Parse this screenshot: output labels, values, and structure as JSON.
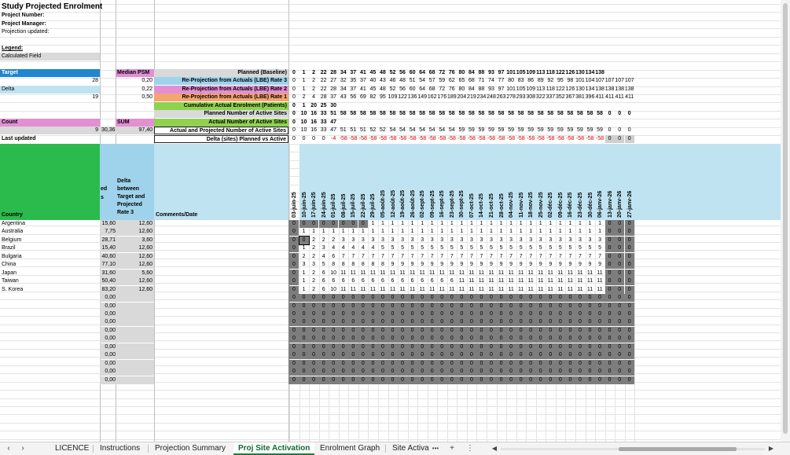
{
  "header": {
    "title": "Study Projected Enrolment",
    "project_number_label": "Project Number:",
    "project_manager_label": "Project Manager:",
    "projection_updated_label": "Projection updated:",
    "legend_label": "Legend:",
    "calculated_field_label": "Calculated Field"
  },
  "stats": {
    "target_label": "Target",
    "target_value": "28",
    "delta_label": "Delta",
    "delta_value": "19",
    "median_psm_label": "Median PSM",
    "median_values": [
      "0,20",
      "0,22",
      "0,50"
    ],
    "count_label": "Count",
    "count_value": "9",
    "count_mid": "30,36",
    "sum_label": "SUM",
    "sum_value": "97,40",
    "last_updated_label": "Last updated"
  },
  "row_labels": [
    "Planned (Baseline)",
    "Re-Projection  from Actuals (LBE) Rate 3",
    "Re-Projection  from Actuals (LBE) Rate 2",
    "Re-Projection  from Actuals (LBE) Rate 1",
    "Cumulative Actual Enrolment (Patients)",
    "Planned Number of Active Sites",
    "Actual Number of Active Sites",
    "Actual and Projected Number of Active Sites",
    "Delta (sites) Planned vs Active"
  ],
  "summary_rows": [
    [
      "0",
      "1",
      "2",
      "22",
      "28",
      "34",
      "37",
      "41",
      "45",
      "48",
      "52",
      "56",
      "60",
      "64",
      "68",
      "72",
      "76",
      "80",
      "84",
      "88",
      "93",
      "97",
      "101",
      "105",
      "109",
      "113",
      "118",
      "122",
      "126",
      "130",
      "134",
      "138"
    ],
    [
      "0",
      "1",
      "2",
      "22",
      "27",
      "32",
      "35",
      "37",
      "40",
      "43",
      "46",
      "48",
      "51",
      "54",
      "57",
      "59",
      "62",
      "65",
      "68",
      "71",
      "74",
      "77",
      "80",
      "83",
      "86",
      "89",
      "92",
      "95",
      "98",
      "101",
      "104",
      "107",
      "107",
      "107",
      "107"
    ],
    [
      "0",
      "1",
      "2",
      "22",
      "28",
      "34",
      "37",
      "41",
      "45",
      "48",
      "52",
      "56",
      "60",
      "64",
      "68",
      "72",
      "76",
      "80",
      "84",
      "88",
      "93",
      "97",
      "101",
      "105",
      "109",
      "113",
      "118",
      "122",
      "126",
      "130",
      "134",
      "138",
      "138",
      "138",
      "138"
    ],
    [
      "0",
      "2",
      "4",
      "28",
      "37",
      "43",
      "56",
      "69",
      "82",
      "95",
      "109",
      "122",
      "136",
      "149",
      "162",
      "176",
      "189",
      "204",
      "219",
      "234",
      "248",
      "263",
      "278",
      "293",
      "308",
      "322",
      "337",
      "352",
      "367",
      "381",
      "396",
      "411",
      "411",
      "411",
      "411"
    ],
    [
      "0",
      "1",
      "20",
      "25",
      "30"
    ],
    [
      "0",
      "10",
      "16",
      "33",
      "51",
      "58",
      "58",
      "58",
      "58",
      "58",
      "58",
      "58",
      "58",
      "58",
      "58",
      "58",
      "58",
      "58",
      "58",
      "58",
      "58",
      "58",
      "58",
      "58",
      "58",
      "58",
      "58",
      "58",
      "58",
      "58",
      "58",
      "58",
      "0",
      "0",
      "0"
    ],
    [
      "0",
      "10",
      "16",
      "33",
      "47"
    ],
    [
      "0",
      "10",
      "16",
      "33",
      "47",
      "51",
      "51",
      "51",
      "52",
      "52",
      "54",
      "54",
      "54",
      "54",
      "54",
      "54",
      "54",
      "59",
      "59",
      "59",
      "59",
      "59",
      "59",
      "59",
      "59",
      "59",
      "59",
      "59",
      "59",
      "59",
      "59",
      "59",
      "0",
      "0",
      "0"
    ],
    [
      "0",
      "0",
      "0",
      "0",
      "-4",
      "-58",
      "-58",
      "-58",
      "-58",
      "-58",
      "-58",
      "-58",
      "-58",
      "-58",
      "-58",
      "-58",
      "-58",
      "-58",
      "-58",
      "-58",
      "-58",
      "-58",
      "-58",
      "-58",
      "-58",
      "-58",
      "-58",
      "-58",
      "-58",
      "-58",
      "-58",
      "-58",
      "0",
      "0",
      "0"
    ]
  ],
  "table_headers": {
    "country": "Country",
    "col_b_fragment_1": "ed",
    "col_b_fragment_2": "s",
    "delta_header": "Delta between Target and Projected Rate 3",
    "comments_header": "Comments/Date"
  },
  "dates": [
    "03-juin-25",
    "10-juin-25",
    "17-juin-25",
    "24-juin-25",
    "01-juil-25",
    "08-juil-25",
    "15-juil-25",
    "22-juil-25",
    "29-juil-25",
    "05-août-25",
    "12-août-25",
    "19-août-25",
    "26-août-25",
    "02-sept-25",
    "09-sept-25",
    "16-sept-25",
    "23-sept-25",
    "30-sept-25",
    "07-oct-25",
    "14-oct-25",
    "21-oct-25",
    "28-oct-25",
    "04-nov-25",
    "11-nov-25",
    "18-nov-25",
    "25-nov-25",
    "02-déc-25",
    "09-déc-25",
    "16-déc-25",
    "23-déc-25",
    "30-déc-25",
    "06-janv-26",
    "13-janv-26",
    "20-janv-26",
    "27-janv-26"
  ],
  "countries": [
    {
      "name": "Argentina",
      "b": "15,60",
      "delta": "12,60",
      "cells": [
        "0",
        "0",
        "0",
        "0",
        "0",
        "0",
        "0",
        "0",
        "1",
        "1",
        "1",
        "1",
        "1",
        "1",
        "1",
        "1",
        "1",
        "1",
        "1",
        "1",
        "1",
        "1",
        "1",
        "1",
        "1",
        "1",
        "1",
        "1",
        "1",
        "1",
        "1",
        "1",
        "0",
        "0",
        "0"
      ]
    },
    {
      "name": "Australia",
      "b": "7,75",
      "delta": "12,60",
      "cells": [
        "0",
        "1",
        "1",
        "1",
        "1",
        "1",
        "1",
        "1",
        "1",
        "1",
        "1",
        "1",
        "1",
        "1",
        "1",
        "1",
        "1",
        "1",
        "1",
        "1",
        "1",
        "1",
        "1",
        "1",
        "1",
        "1",
        "1",
        "1",
        "1",
        "1",
        "1",
        "1",
        "0",
        "0",
        "0"
      ]
    },
    {
      "name": "Belgium",
      "b": "28,71",
      "delta": "3,60",
      "cells": [
        "0",
        "0",
        "2",
        "2",
        "2",
        "3",
        "3",
        "3",
        "3",
        "3",
        "3",
        "3",
        "3",
        "3",
        "3",
        "3",
        "3",
        "3",
        "3",
        "3",
        "3",
        "3",
        "3",
        "3",
        "3",
        "3",
        "3",
        "3",
        "3",
        "3",
        "3",
        "3",
        "0",
        "0",
        "0"
      ]
    },
    {
      "name": "Brazil",
      "b": "15,40",
      "delta": "12,60",
      "cells": [
        "0",
        "1",
        "2",
        "3",
        "4",
        "4",
        "4",
        "4",
        "4",
        "5",
        "5",
        "5",
        "5",
        "5",
        "5",
        "5",
        "5",
        "5",
        "5",
        "5",
        "5",
        "5",
        "5",
        "5",
        "5",
        "5",
        "5",
        "5",
        "5",
        "5",
        "5",
        "5",
        "0",
        "0",
        "0"
      ]
    },
    {
      "name": "Bulgaria",
      "b": "40,60",
      "delta": "12,60",
      "cells": [
        "0",
        "2",
        "2",
        "4",
        "6",
        "7",
        "7",
        "7",
        "7",
        "7",
        "7",
        "7",
        "7",
        "7",
        "7",
        "7",
        "7",
        "7",
        "7",
        "7",
        "7",
        "7",
        "7",
        "7",
        "7",
        "7",
        "7",
        "7",
        "7",
        "7",
        "7",
        "7",
        "0",
        "0",
        "0"
      ]
    },
    {
      "name": "China",
      "b": "77,10",
      "delta": "12,60",
      "cells": [
        "0",
        "3",
        "3",
        "5",
        "8",
        "8",
        "8",
        "8",
        "8",
        "8",
        "9",
        "9",
        "9",
        "9",
        "9",
        "9",
        "9",
        "9",
        "9",
        "9",
        "9",
        "9",
        "9",
        "9",
        "9",
        "9",
        "9",
        "9",
        "9",
        "9",
        "9",
        "9",
        "0",
        "0",
        "0"
      ]
    },
    {
      "name": "Japan",
      "b": "31,60",
      "delta": "5,60",
      "cells": [
        "0",
        "1",
        "2",
        "6",
        "10",
        "11",
        "11",
        "11",
        "11",
        "11",
        "11",
        "11",
        "11",
        "11",
        "11",
        "11",
        "11",
        "11",
        "11",
        "11",
        "11",
        "11",
        "11",
        "11",
        "11",
        "11",
        "11",
        "11",
        "11",
        "11",
        "11",
        "11",
        "0",
        "0",
        "0"
      ]
    },
    {
      "name": "Taiwan",
      "b": "50,40",
      "delta": "12,60",
      "cells": [
        "0",
        "1",
        "2",
        "6",
        "6",
        "6",
        "6",
        "6",
        "6",
        "6",
        "6",
        "6",
        "6",
        "6",
        "6",
        "6",
        "6",
        "11",
        "11",
        "11",
        "11",
        "11",
        "11",
        "11",
        "11",
        "11",
        "11",
        "11",
        "11",
        "11",
        "11",
        "11",
        "0",
        "0",
        "0"
      ]
    },
    {
      "name": "S. Korea",
      "b": "83,20",
      "delta": "12,60",
      "cells": [
        "0",
        "1",
        "2",
        "6",
        "10",
        "11",
        "11",
        "11",
        "11",
        "11",
        "11",
        "11",
        "11",
        "11",
        "11",
        "11",
        "11",
        "11",
        "11",
        "11",
        "11",
        "11",
        "11",
        "11",
        "11",
        "11",
        "11",
        "11",
        "11",
        "11",
        "11",
        "11",
        "0",
        "0",
        "0"
      ]
    }
  ],
  "empty_rows_b": [
    "0,00",
    "0,00",
    "0,00",
    "0,00",
    "0,00",
    "0,00",
    "0,00",
    "0,00",
    "0,00",
    "0,00",
    "0,00"
  ],
  "tabs": {
    "items": [
      "LICENCE",
      "Instructions",
      "Projection Summary",
      "Proj Site Activation",
      "Enrolment Graph",
      "Site Activa"
    ],
    "active_index": 3,
    "more": "•••",
    "add": "+",
    "menu": "⋮"
  },
  "colors": {
    "target_blue": "#1f86d1",
    "light_blue": "#bfe3f1",
    "green_header": "#2bbb4c",
    "median_magenta": "#e290d2",
    "rate1_orange": "#f4a571",
    "actual_green": "#8fd24f",
    "dark_cell": "#7d7d7d",
    "negative_red": "#d40000"
  }
}
